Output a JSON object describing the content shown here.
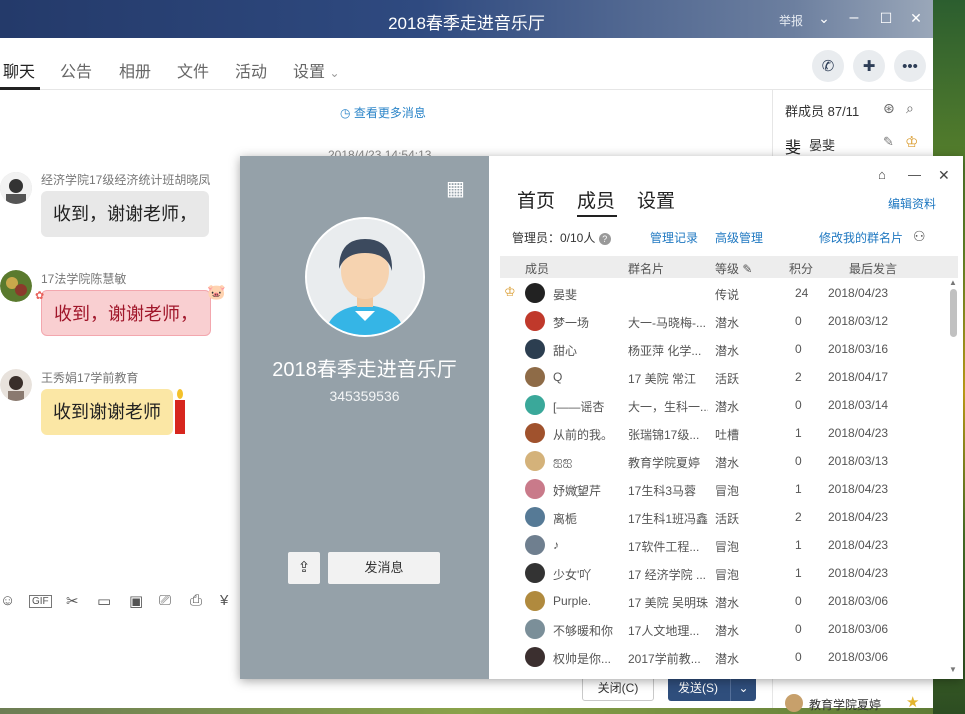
{
  "window": {
    "title": "2018春季走进音乐厅",
    "report_label": "举报"
  },
  "tabs": [
    "聊天",
    "公告",
    "相册",
    "文件",
    "活动",
    "设置"
  ],
  "chat": {
    "more_messages": "查看更多消息",
    "timestamp": "2018/4/23 14:54:13",
    "messages": [
      {
        "sender": "经济学院17级经济统计班胡晓凤",
        "text": "收到，谢谢老师，"
      },
      {
        "sender": "17法学院陈慧敏",
        "text": "收到，谢谢老师，"
      },
      {
        "sender": "王秀娟17学前教育",
        "text": "收到谢谢老师"
      }
    ],
    "close_label": "关闭(C)",
    "send_label": "发送(S)"
  },
  "member_panel": {
    "header": "群成员 87/11",
    "first_member": "晏斐",
    "bottom_member": "教育学院夏婷"
  },
  "popup": {
    "group_name": "2018春季走进音乐厅",
    "group_id": "345359536",
    "send_message": "发消息",
    "tabs": [
      "首页",
      "成员",
      "设置"
    ],
    "edit_info": "编辑资料",
    "admins": "管理员：0/10人",
    "links": [
      "管理记录",
      "高级管理",
      "修改我的群名片"
    ],
    "columns": [
      "成员",
      "群名片",
      "等级",
      "积分",
      "最后发言"
    ],
    "members": [
      {
        "name": "晏斐",
        "card": "",
        "level": "传说",
        "points": "24",
        "last": "2018/04/23",
        "color": "#222"
      },
      {
        "name": "梦一场",
        "card": "大一-马晓梅-...",
        "level": "潜水",
        "points": "0",
        "last": "2018/03/12",
        "color": "#c0392b"
      },
      {
        "name": "甜心",
        "card": "杨亚萍 化学...",
        "level": "潜水",
        "points": "0",
        "last": "2018/03/16",
        "color": "#2c3e50"
      },
      {
        "name": "Q",
        "card": "17 美院 常江",
        "level": "活跃",
        "points": "2",
        "last": "2018/04/17",
        "color": "#8e6b47"
      },
      {
        "name": "[——谣杏",
        "card": "大一，生科一...",
        "level": "潜水",
        "points": "0",
        "last": "2018/03/14",
        "color": "#3aa89a"
      },
      {
        "name": "从前的我。",
        "card": "张瑞锦17级...",
        "level": "吐槽",
        "points": "1",
        "last": "2018/04/23",
        "color": "#a0522d"
      },
      {
        "name": "ஐஐ",
        "card": "教育学院夏婷",
        "level": "潜水",
        "points": "0",
        "last": "2018/03/13",
        "color": "#d4b27a"
      },
      {
        "name": "妤媺҉望芹",
        "card": "17生科3马蓉",
        "level": "冒泡",
        "points": "1",
        "last": "2018/04/23",
        "color": "#c97a8a"
      },
      {
        "name": "离栀",
        "card": "17生科1班冯鑫",
        "level": "活跃",
        "points": "2",
        "last": "2018/04/23",
        "color": "#567a96"
      },
      {
        "name": "♪",
        "card": "17软件工程...",
        "level": "冒泡",
        "points": "1",
        "last": "2018/04/23",
        "color": "#6f7f8f"
      },
      {
        "name": "少女'吖",
        "card": "17 经济学院 ...",
        "level": "冒泡",
        "points": "1",
        "last": "2018/04/23",
        "color": "#333"
      },
      {
        "name": "Purple.",
        "card": "17 美院 吴明珠",
        "level": "潜水",
        "points": "0",
        "last": "2018/03/06",
        "color": "#b08a3e"
      },
      {
        "name": "不够暖和你",
        "card": "17人文地理...",
        "level": "潜水",
        "points": "0",
        "last": "2018/03/06",
        "color": "#7b8f99"
      },
      {
        "name": "权帅是你...",
        "card": "2017学前教...",
        "level": "潜水",
        "points": "0",
        "last": "2018/03/06",
        "color": "#3b2f2f"
      }
    ]
  }
}
